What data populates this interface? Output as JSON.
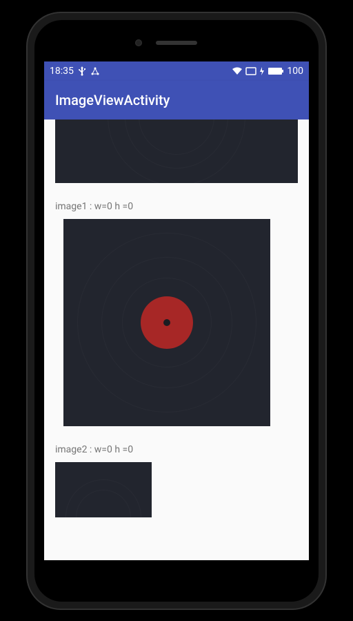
{
  "status": {
    "time": "18:35",
    "battery_level": "100"
  },
  "app": {
    "title": "ImageViewActivity"
  },
  "items": [
    {
      "label": "image1 : w=0 h =0"
    },
    {
      "label": "image2 : w=0 h =0"
    }
  ],
  "colors": {
    "primary": "#3f51b5",
    "surface": "#22252e",
    "record_center": "#a72726"
  }
}
